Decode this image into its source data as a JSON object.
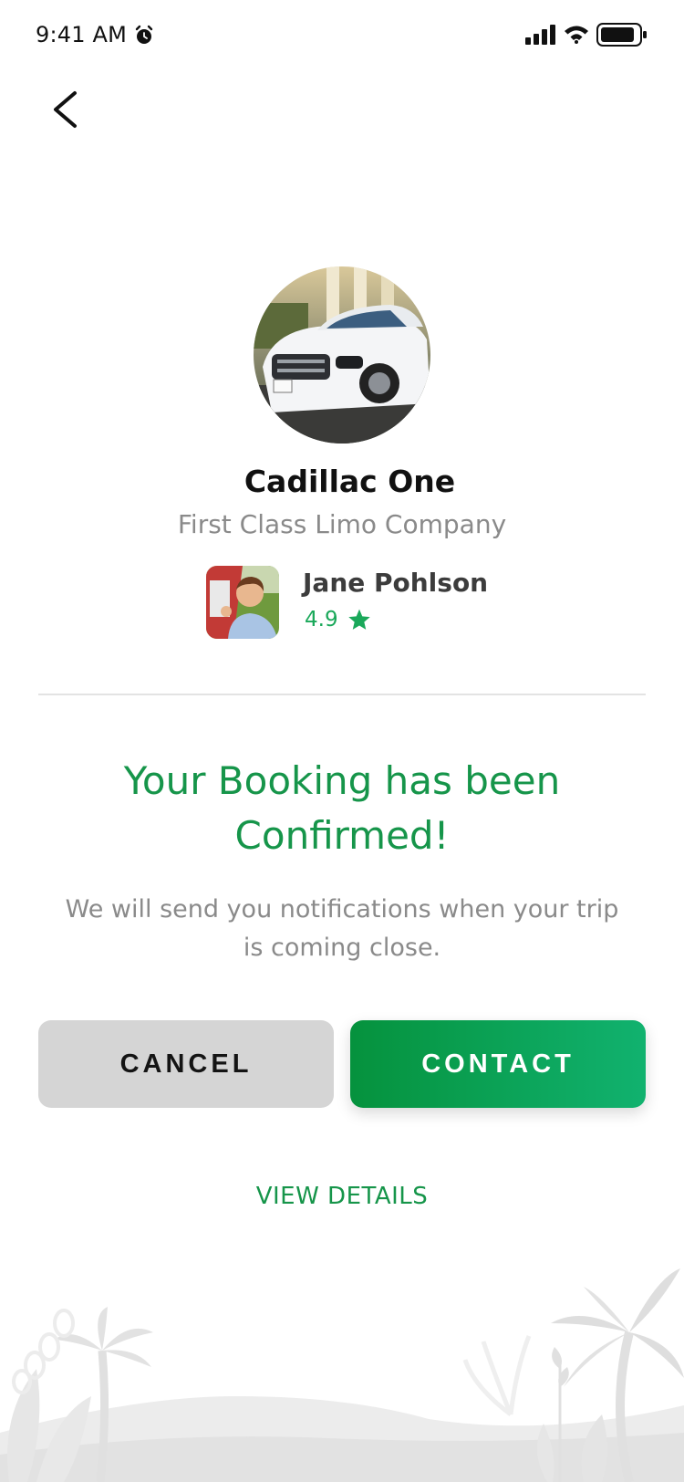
{
  "status_bar": {
    "time": "9:41 AM"
  },
  "icons": {
    "back": "chevron-left-icon",
    "alarm": "alarm-clock-icon",
    "signal": "cellular-signal-icon",
    "wifi": "wifi-icon",
    "battery": "battery-icon",
    "star": "star-icon"
  },
  "vehicle": {
    "name": "Cadillac One",
    "company": "First Class Limo Company"
  },
  "driver": {
    "name": "Jane Pohlson",
    "rating": "4.9"
  },
  "confirmation": {
    "title": "Your Booking has been Confirmed!",
    "message": "We will send you notifications when your trip is coming close."
  },
  "actions": {
    "cancel_label": "CANCEL",
    "contact_label": "CONTACT",
    "view_details_label": "VIEW DETAILS"
  },
  "colors": {
    "accent_green": "#16954a",
    "button_gradient_start": "#05923d",
    "button_gradient_end": "#11b26f",
    "cancel_bg": "#d5d5d5",
    "muted_text": "#8a8a8a"
  }
}
